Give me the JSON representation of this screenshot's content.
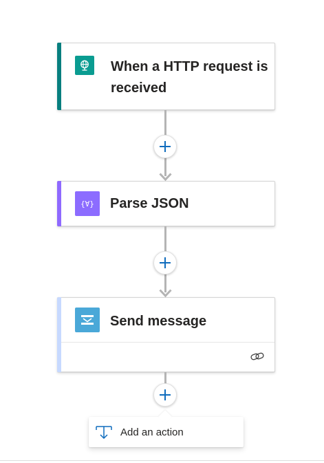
{
  "flow": {
    "steps": [
      {
        "title": "When a HTTP request is received",
        "icon": "globe-request-icon",
        "accent_color": "#077f7f",
        "icon_color": "#0a9c91"
      },
      {
        "title": "Parse JSON",
        "icon": "json-braces-icon",
        "accent_color": "#8f69ff",
        "icon_color": "#8c6cff"
      },
      {
        "title": "Send message",
        "icon": "message-icon",
        "accent_color": "#c7d9ff",
        "icon_color": "#4aa8d8"
      }
    ],
    "insert_step_icon": "plus-icon",
    "connection_icon": "link-icon"
  },
  "add_action_menu": {
    "label": "Add an action",
    "icon": "insert-action-icon"
  },
  "colors": {
    "plus_blue": "#0f6cbd",
    "connector_gray": "#b4b4b4"
  }
}
